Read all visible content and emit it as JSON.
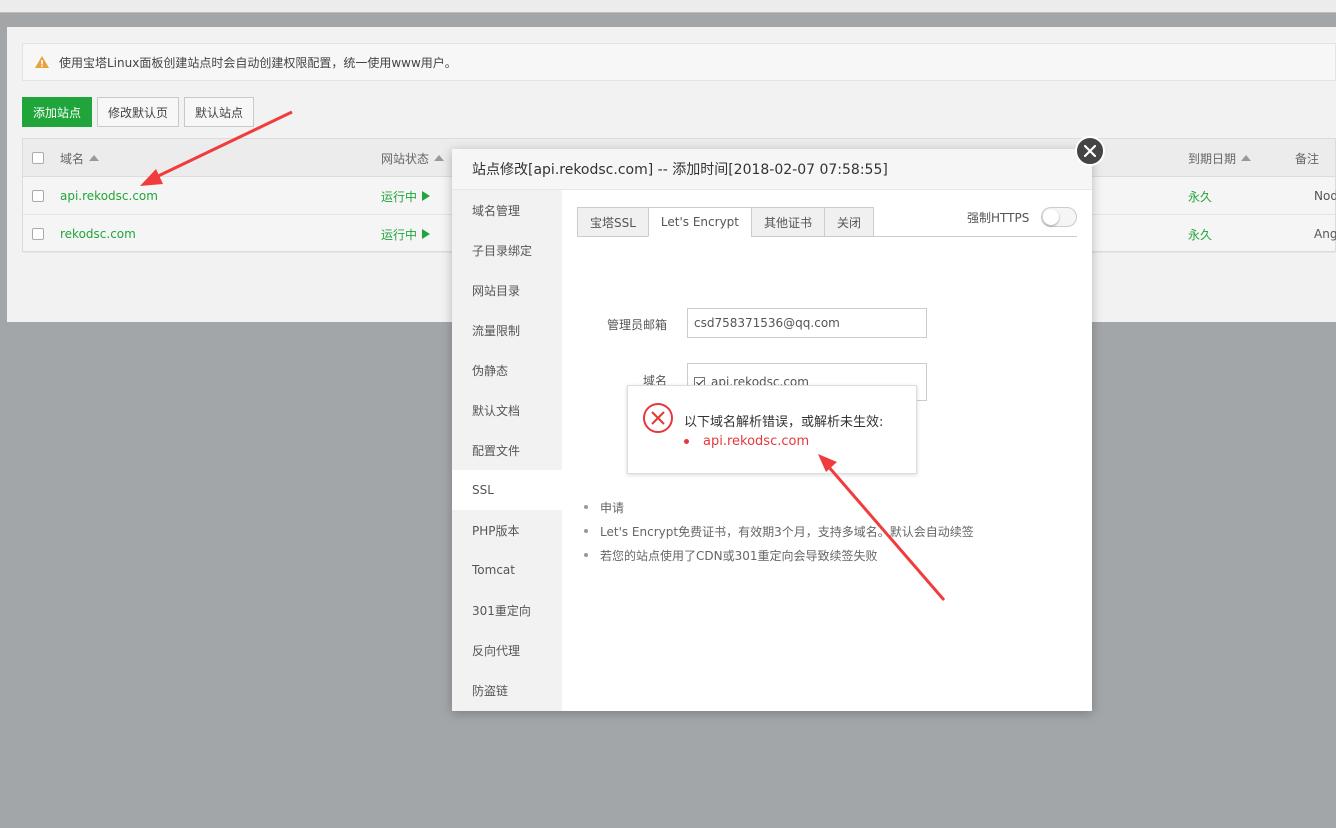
{
  "notice": {
    "text": "使用宝塔Linux面板创建站点时会自动创建权限配置，统一使用www用户。"
  },
  "toolbar": {
    "add_site": "添加站点",
    "edit_default_page": "修改默认页",
    "default_site": "默认站点"
  },
  "table": {
    "headers": {
      "domain": "域名",
      "status": "网站状态",
      "expire": "到期日期",
      "remark": "备注"
    },
    "rows": [
      {
        "domain": "api.rekodsc.com",
        "status": "运行中",
        "expire": "永久",
        "remark": "Nod"
      },
      {
        "domain": "rekodsc.com",
        "status": "运行中",
        "expire": "永久",
        "remark": "Ang"
      }
    ]
  },
  "modal": {
    "title": "站点修改[api.rekodsc.com] -- 添加时间[2018-02-07 07:58:55]",
    "sidebar": [
      "域名管理",
      "子目录绑定",
      "网站目录",
      "流量限制",
      "伪静态",
      "默认文档",
      "配置文件",
      "SSL",
      "PHP版本",
      "Tomcat",
      "301重定向",
      "反向代理",
      "防盗链"
    ],
    "active_sidebar": "SSL",
    "tabs": [
      "宝塔SSL",
      "Let's Encrypt",
      "其他证书",
      "关闭"
    ],
    "active_tab": "Let's Encrypt",
    "force_https_label": "强制HTTPS",
    "force_https_on": false,
    "email_label": "管理员邮箱",
    "email_value": "csd758371536@qq.com",
    "domain_label": "域名",
    "domain_value": "api.rekodsc.com",
    "tips": [
      "申请",
      "Let's Encrypt免费证书，有效期3个月，支持多域名。默认会自动续签",
      "若您的站点使用了CDN或301重定向会导致续签失败"
    ]
  },
  "error_popup": {
    "title": "以下域名解析错误，或解析未生效:",
    "domain": "api.rekodsc.com"
  },
  "colors": {
    "accent": "#20a53a",
    "error": "#e4393c",
    "arrow": "#f03c3c"
  }
}
